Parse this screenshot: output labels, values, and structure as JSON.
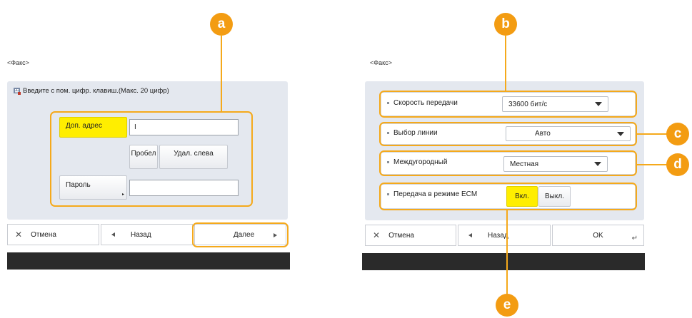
{
  "callouts": {
    "a": "a",
    "b": "b",
    "c": "c",
    "d": "d",
    "e": "e"
  },
  "left": {
    "screen_title": "<Факс>",
    "header_text": "Введите с пом. цифр. клавиш.(Макс. 20 цифр)",
    "sub_address_button": "Доп. адрес",
    "sub_address_value": "I",
    "space_button": "Пробел",
    "delete_left_button": "Удал. слева",
    "password_button": "Пароль",
    "password_value": "",
    "cancel_button": "Отмена",
    "back_button": "Назад",
    "next_button": "Далее"
  },
  "right": {
    "screen_title": "<Факс>",
    "rows": [
      {
        "label": "Скорость передачи",
        "value": "33600 бит/с"
      },
      {
        "label": "Выбор линии",
        "value": "Авто"
      },
      {
        "label": "Междугородный",
        "value": "Местная"
      }
    ],
    "ecm_label": "Передача в режиме ECM",
    "ecm_on": "Вкл.",
    "ecm_off": "Выкл.",
    "cancel_button": "Отмена",
    "back_button": "Назад",
    "ok_button": "OK"
  },
  "colors": {
    "highlight": "#f5a91b",
    "accent_yellow": "#ffee00",
    "panel": "#e4e8ef"
  }
}
